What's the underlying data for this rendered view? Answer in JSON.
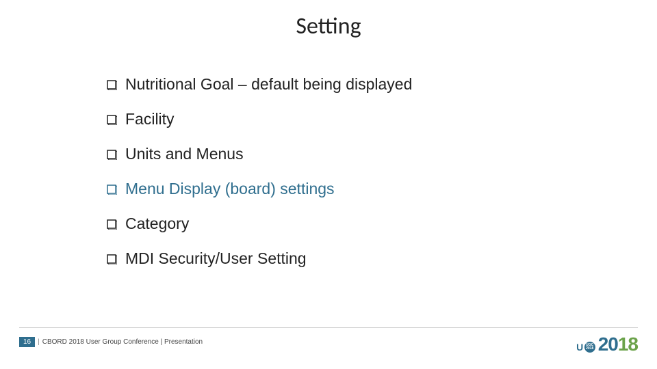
{
  "title": "Setting",
  "bullets": [
    {
      "text": "Nutritional Goal – default being displayed",
      "highlight": false
    },
    {
      "text": "Facility",
      "highlight": false
    },
    {
      "text": "Units and Menus",
      "highlight": false
    },
    {
      "text": "Menu Display (board) settings",
      "highlight": true
    },
    {
      "text": "Category",
      "highlight": false
    },
    {
      "text": "MDI Security/User Setting",
      "highlight": false
    }
  ],
  "footer": {
    "page": "16",
    "text": "CBORD 2018 User Group Conference | Presentation"
  },
  "logo": {
    "badge_top": "UGC",
    "badge_bottom": "2018",
    "first_letter": "U",
    "year_a": "20",
    "year_b": "18"
  }
}
